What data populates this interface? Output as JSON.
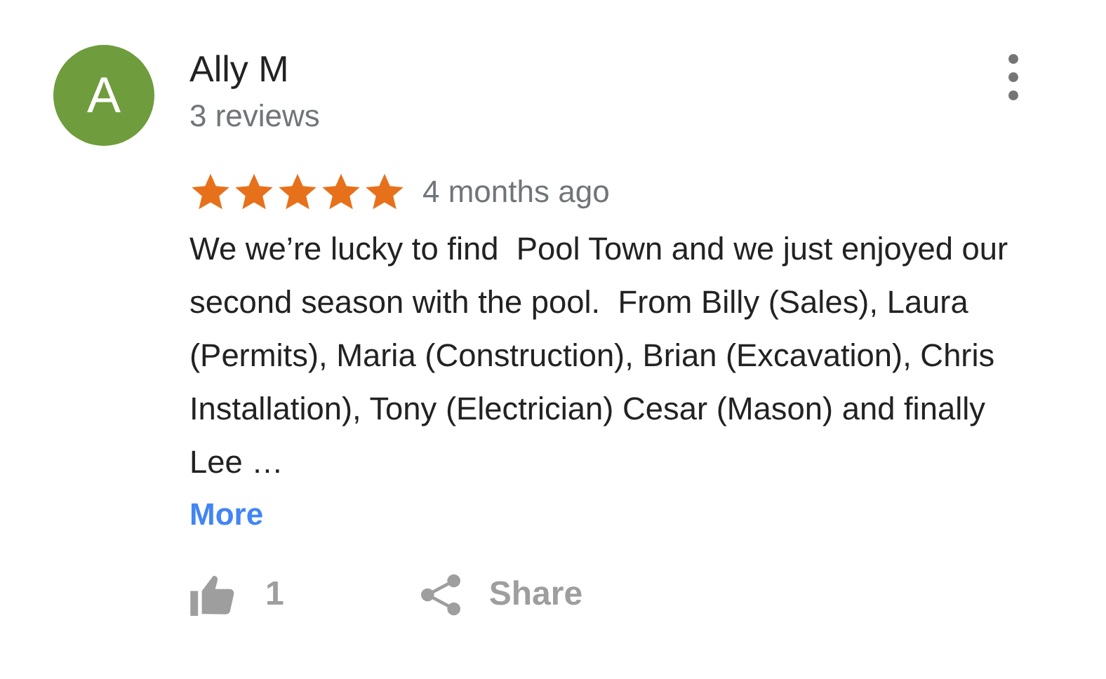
{
  "reviewer": {
    "initial": "A",
    "name": "Ally M",
    "reviews": "3 reviews"
  },
  "review": {
    "stars": 5,
    "time": "4 months ago",
    "text": "We we’re lucky to find  Pool Town and we just enjoyed our second season with the pool.  From Billy (Sales), Laura (Permits), Maria (Construction), Brian (Excavation), Chris Installation), Tony (Electrician) Cesar (Mason) and finally Lee …",
    "more": "More"
  },
  "actions": {
    "likes": "1",
    "share": "Share"
  }
}
